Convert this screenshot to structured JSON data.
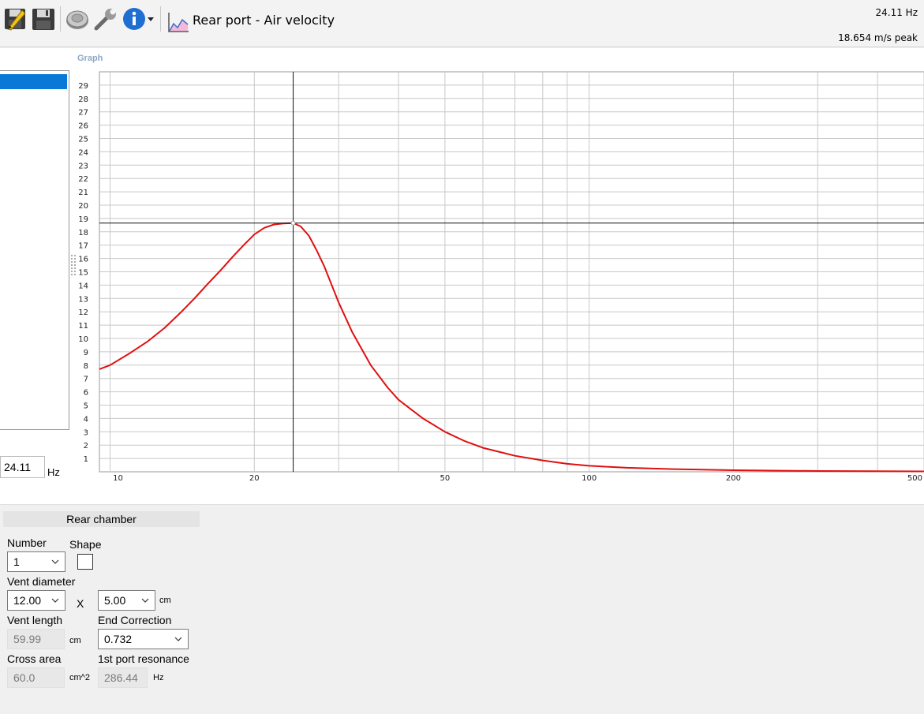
{
  "toolbar": {
    "title": "Rear port - Air velocity",
    "icons": [
      "edit-save-icon",
      "save-icon",
      "speaker-icon",
      "wrench-icon",
      "info-icon",
      "dropdown-arrow-icon",
      "graph-icon"
    ]
  },
  "readout": {
    "frequency": "24.11 Hz",
    "value": "18.654 m/s peak"
  },
  "graph": {
    "label": "Graph",
    "frequency_value": "24.11",
    "frequency_unit": "Hz"
  },
  "chart_data": {
    "type": "line",
    "x_scale": "log",
    "xlim": [
      9.5,
      500
    ],
    "ylim": [
      0,
      30
    ],
    "x_ticks": [
      10,
      20,
      50,
      100,
      200,
      500
    ],
    "y_ticks": [
      1,
      2,
      3,
      4,
      5,
      6,
      7,
      8,
      9,
      10,
      11,
      12,
      13,
      14,
      15,
      16,
      17,
      18,
      19,
      20,
      21,
      22,
      23,
      24,
      25,
      26,
      27,
      28,
      29
    ],
    "cursor": {
      "x": 24.11,
      "y": 18.654
    },
    "grid": true,
    "series": [
      {
        "color": "#e01010",
        "x": [
          9.5,
          10,
          11,
          12,
          13,
          14,
          15,
          16,
          17,
          18,
          19,
          20,
          21,
          22,
          23,
          24.11,
          25,
          26,
          27,
          28,
          30,
          32,
          35,
          38,
          40,
          45,
          50,
          55,
          60,
          70,
          80,
          90,
          100,
          120,
          150,
          200,
          300,
          400,
          500
        ],
        "y": [
          7.7,
          8.0,
          8.9,
          9.8,
          10.8,
          11.9,
          13.0,
          14.1,
          15.1,
          16.1,
          17.0,
          17.8,
          18.3,
          18.55,
          18.62,
          18.654,
          18.4,
          17.7,
          16.6,
          15.4,
          12.7,
          10.5,
          8.0,
          6.3,
          5.4,
          4.0,
          3.0,
          2.3,
          1.8,
          1.2,
          0.85,
          0.6,
          0.45,
          0.3,
          0.2,
          0.12,
          0.06,
          0.04,
          0.03
        ]
      }
    ]
  },
  "panel": {
    "section_title": "Rear chamber",
    "number_label": "Number",
    "number_value": "1",
    "shape_label": "Shape",
    "vent_diameter_label": "Vent diameter",
    "vent_diameter_value": "12.00",
    "x_label": "X",
    "vent_second_value": "5.00",
    "cm_unit": "cm",
    "vent_length_label": "Vent length",
    "vent_length_value": "59.99",
    "end_correction_label": "End Correction",
    "end_correction_value": "0.732",
    "cross_area_label": "Cross area",
    "cross_area_value": "60.0",
    "cross_area_unit": "cm^2",
    "port_resonance_label": "1st port resonance",
    "port_resonance_value": "286.44",
    "hz_unit": "Hz"
  }
}
